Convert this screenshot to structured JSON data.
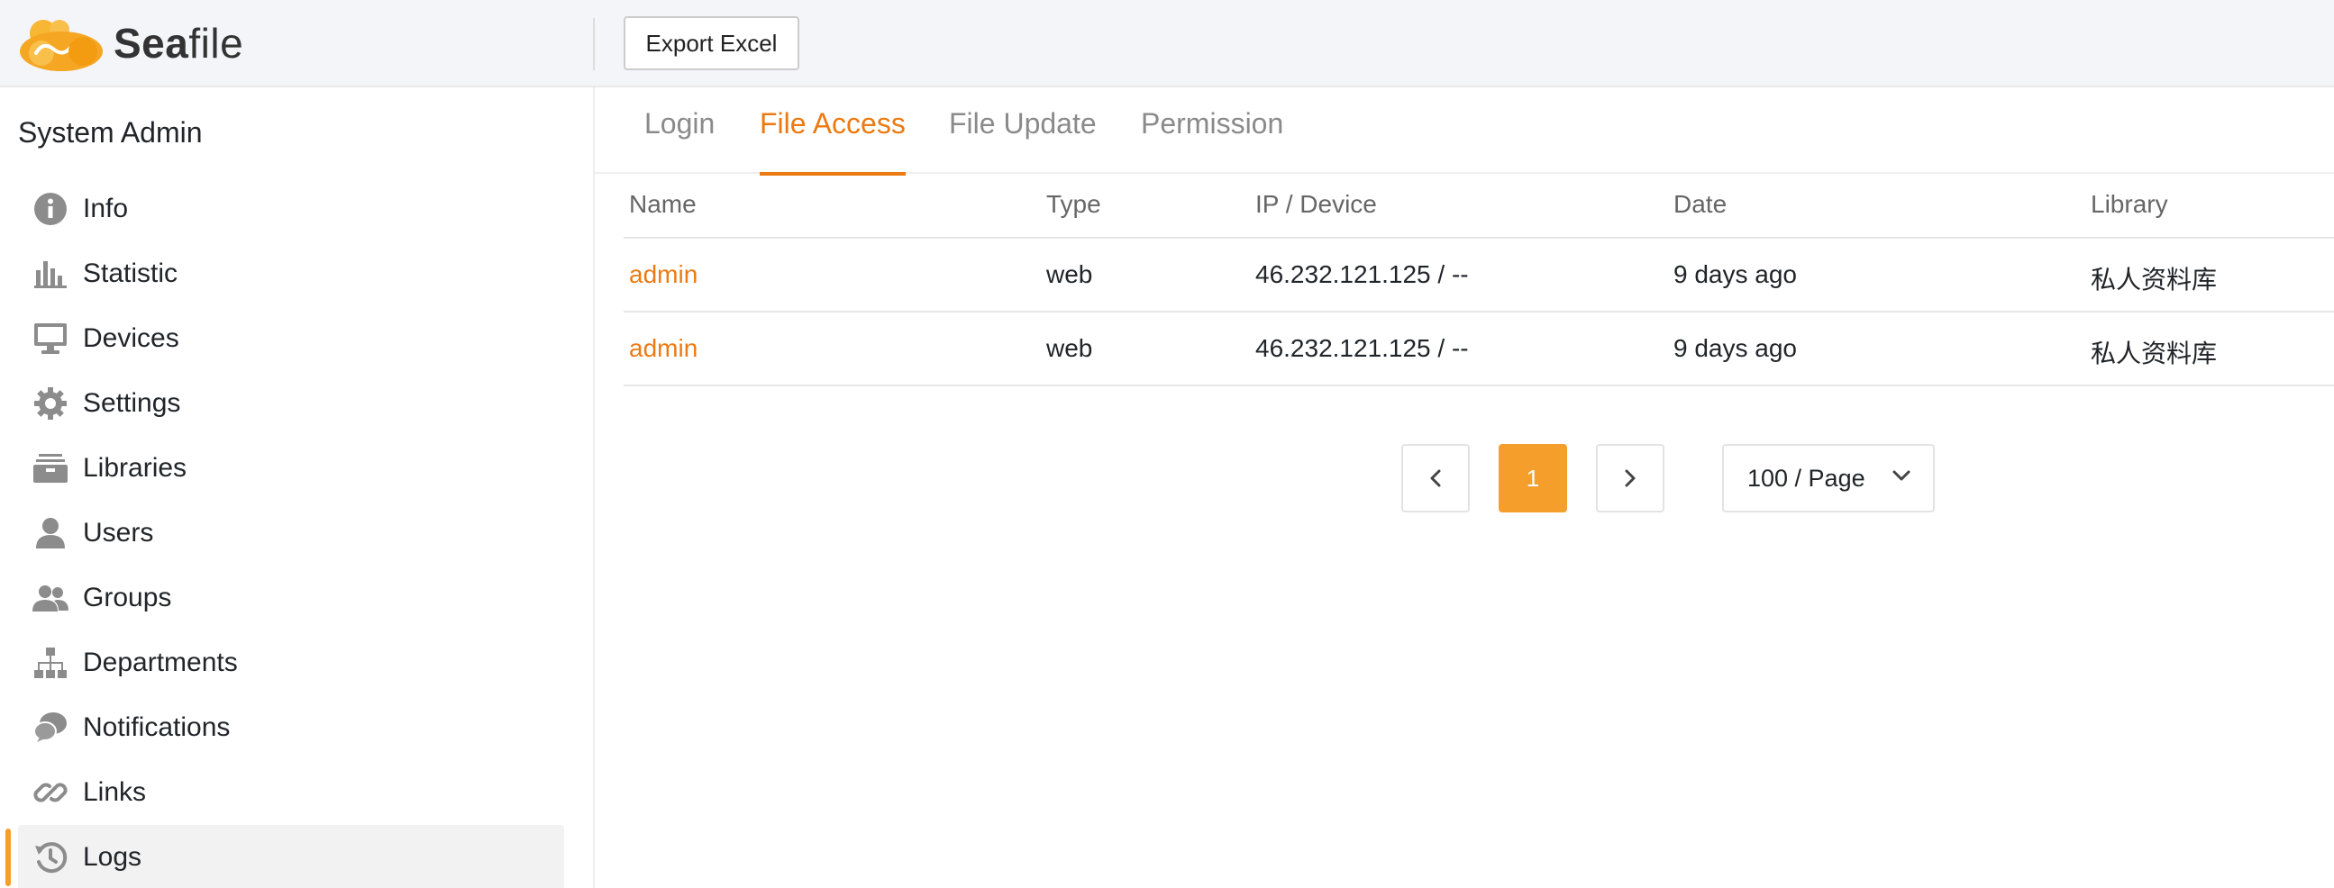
{
  "header": {
    "logo_bold": "Sea",
    "logo_light": "file",
    "export_label": "Export Excel"
  },
  "sidebar": {
    "title": "System Admin",
    "items": [
      {
        "label": "Info",
        "icon": "info-icon"
      },
      {
        "label": "Statistic",
        "icon": "bar-chart-icon"
      },
      {
        "label": "Devices",
        "icon": "monitor-icon"
      },
      {
        "label": "Settings",
        "icon": "gear-icon"
      },
      {
        "label": "Libraries",
        "icon": "archive-icon"
      },
      {
        "label": "Users",
        "icon": "user-icon"
      },
      {
        "label": "Groups",
        "icon": "group-icon"
      },
      {
        "label": "Departments",
        "icon": "org-chart-icon"
      },
      {
        "label": "Notifications",
        "icon": "chat-bubbles-icon"
      },
      {
        "label": "Links",
        "icon": "link-icon"
      },
      {
        "label": "Logs",
        "icon": "history-icon",
        "active": true
      }
    ]
  },
  "tabs": [
    {
      "label": "Login"
    },
    {
      "label": "File Access",
      "active": true
    },
    {
      "label": "File Update"
    },
    {
      "label": "Permission"
    }
  ],
  "table": {
    "columns": [
      "Name",
      "Type",
      "IP / Device",
      "Date",
      "Library"
    ],
    "rows": [
      [
        "admin",
        "web",
        "46.232.121.125 / --",
        "9 days ago",
        "私人资料库"
      ],
      [
        "admin",
        "web",
        "46.232.121.125 / --",
        "9 days ago",
        "私人资料库"
      ]
    ]
  },
  "pagination": {
    "current_page": "1",
    "per_page": "100 / Page"
  },
  "colors": {
    "accent": "#ec7a12",
    "active_page": "#f59e2b"
  }
}
